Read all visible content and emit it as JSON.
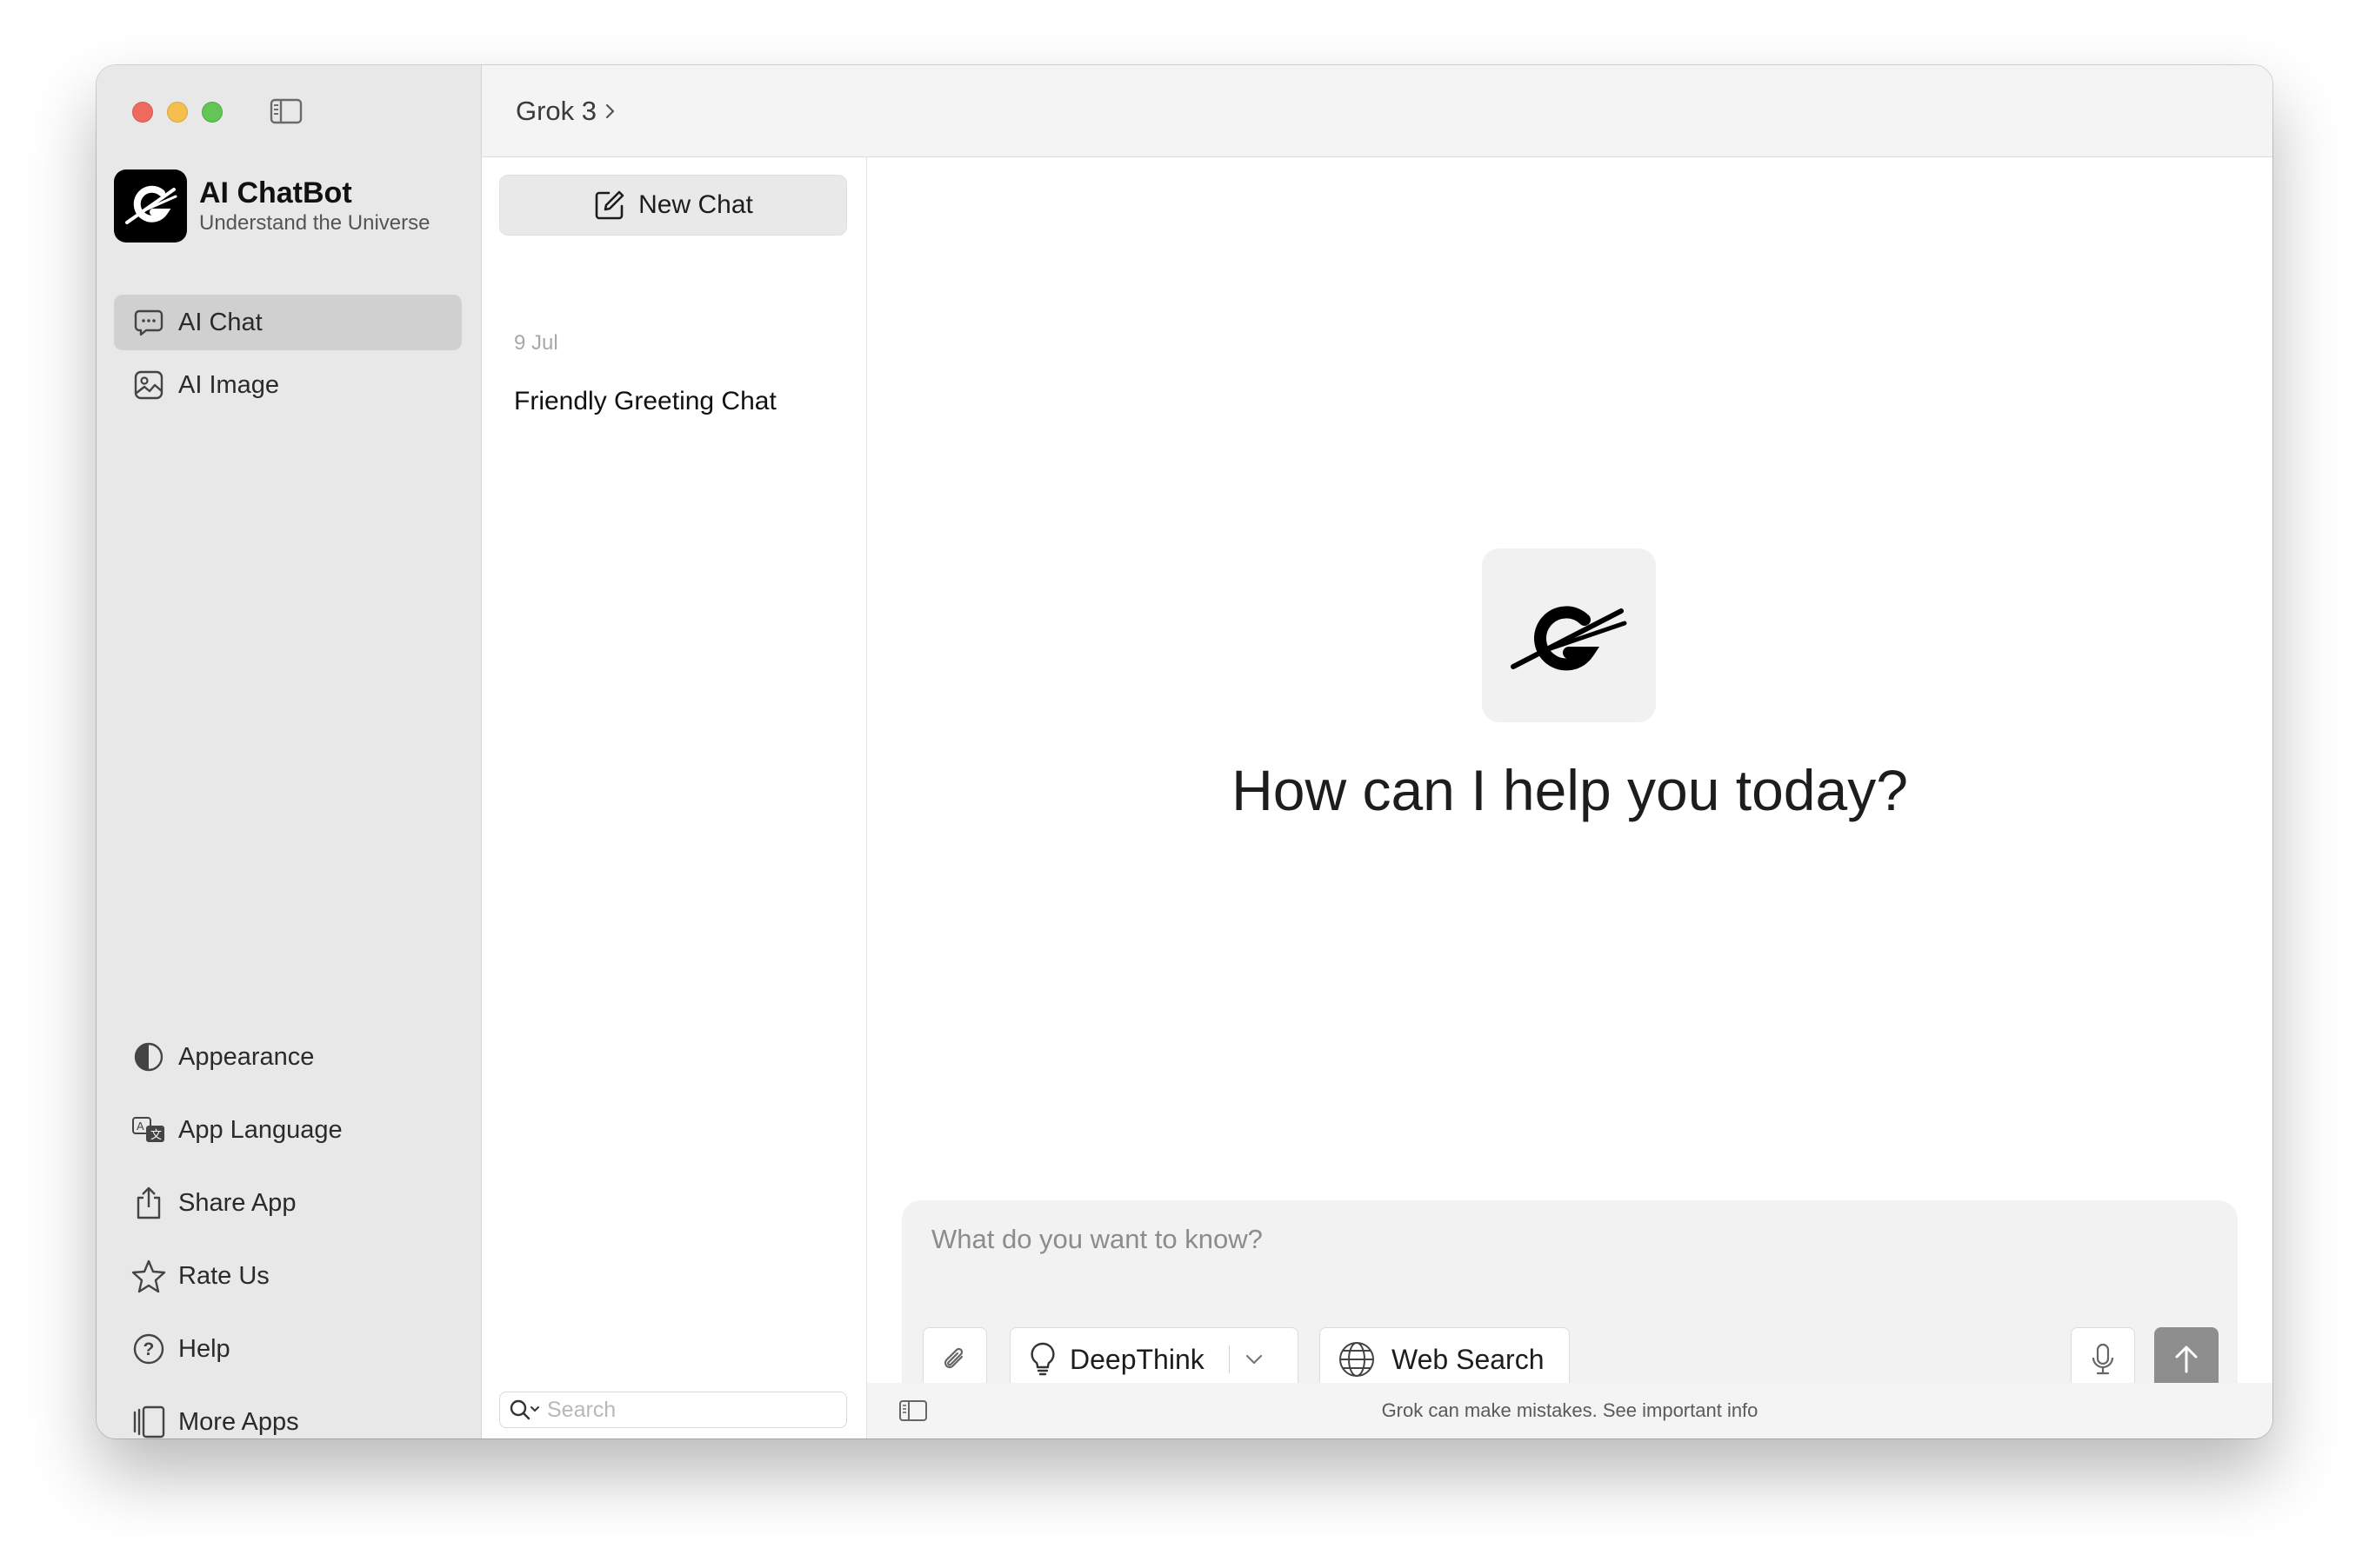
{
  "header": {
    "title": "Grok 3"
  },
  "brand": {
    "title": "AI ChatBot",
    "subtitle": "Understand the Universe"
  },
  "sidebar": {
    "items": [
      {
        "label": "AI Chat",
        "icon": "chat-bubble-icon",
        "active": true
      },
      {
        "label": "AI Image",
        "icon": "image-icon",
        "active": false
      }
    ],
    "bottom_items": [
      {
        "label": "Appearance",
        "icon": "half-circle-icon"
      },
      {
        "label": "App Language",
        "icon": "translate-icon"
      },
      {
        "label": "Share App",
        "icon": "share-icon"
      },
      {
        "label": "Rate Us",
        "icon": "star-icon"
      },
      {
        "label": "Help",
        "icon": "question-circle-icon"
      },
      {
        "label": "More Apps",
        "icon": "more-apps-icon"
      }
    ]
  },
  "chat_list": {
    "new_chat_label": "New Chat",
    "groups": [
      {
        "date": "9 Jul",
        "chats": [
          "Friendly Greeting Chat"
        ]
      }
    ],
    "search_placeholder": "Search"
  },
  "main": {
    "greeting": "How can I help you today?",
    "composer": {
      "placeholder": "What do you want to know?",
      "deepthink_label": "DeepThink",
      "websearch_label": "Web Search"
    },
    "disclaimer": "Grok can make mistakes. See important info"
  },
  "colors": {
    "sidebar_bg": "#e8e8e8",
    "active_item_bg": "#d0d0d0",
    "composer_bg": "#f2f2f2",
    "send_button": "#8e8e8e"
  }
}
